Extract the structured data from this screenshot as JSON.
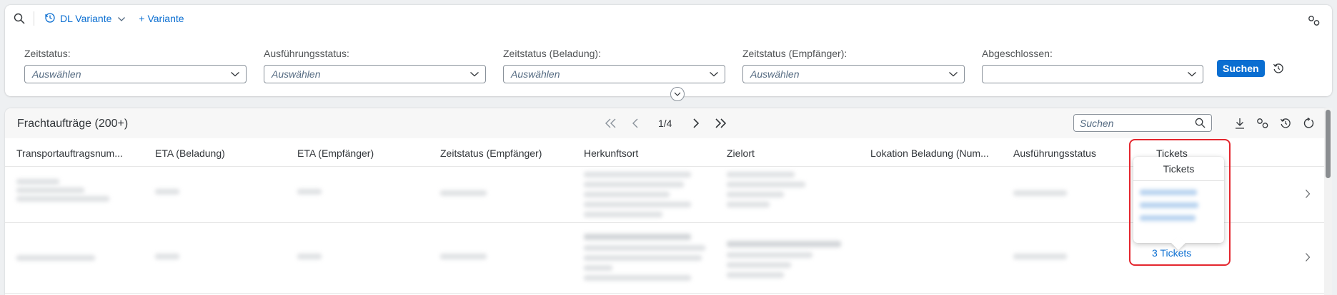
{
  "variant_bar": {
    "variant_name": "DL Variante",
    "add_variant": "+ Variante"
  },
  "filters": [
    {
      "label": "Zeitstatus:",
      "placeholder": "Auswählen"
    },
    {
      "label": "Ausführungsstatus:",
      "placeholder": "Auswählen"
    },
    {
      "label": "Zeitstatus (Beladung):",
      "placeholder": "Auswählen"
    },
    {
      "label": "Zeitstatus (Empfänger):",
      "placeholder": "Auswählen"
    },
    {
      "label": "Abgeschlossen:",
      "placeholder": ""
    }
  ],
  "search_button": "Suchen",
  "table": {
    "title": "Frachtaufträge (200+)",
    "page_indicator": "1/4",
    "search_placeholder": "Suchen",
    "columns": [
      "Transportauftragsnum...",
      "ETA (Beladung)",
      "ETA (Empfänger)",
      "Zeitstatus (Empfänger)",
      "Herkunftsort",
      "Zielort",
      "Lokation Beladung (Num...",
      "Ausführungsstatus",
      "Tickets"
    ],
    "row2_tickets_link": "3 Tickets"
  },
  "popover": {
    "title": "Tickets"
  },
  "colors": {
    "accent": "#0a6ed1",
    "highlight": "#e4262e"
  },
  "icons": [
    "search-icon",
    "variant-history-icon",
    "chevron-down-icon",
    "settings-icon",
    "reset-icon",
    "collapse-icon",
    "first-page-icon",
    "prev-page-icon",
    "next-page-icon",
    "last-page-icon",
    "download-icon",
    "refresh-icon",
    "chevron-right-icon"
  ]
}
